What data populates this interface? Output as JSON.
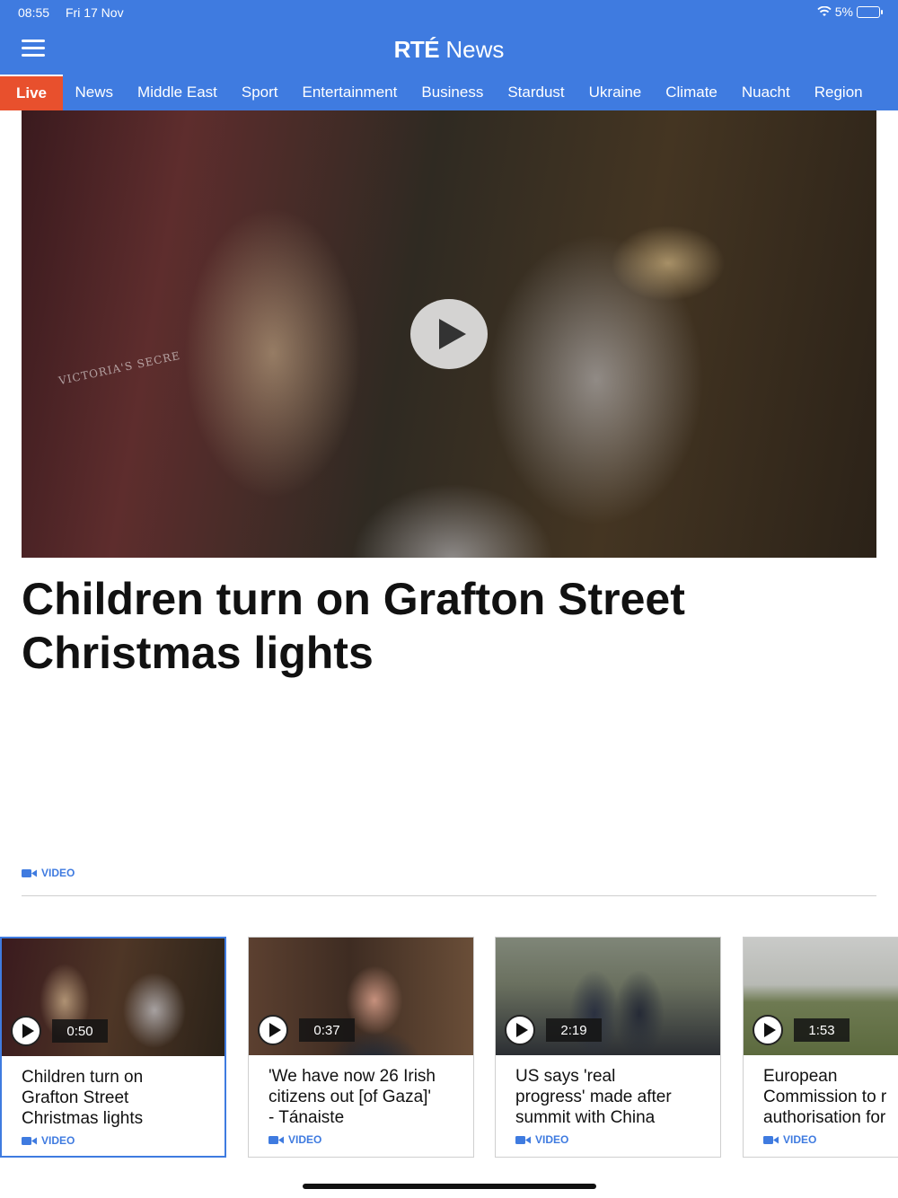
{
  "status": {
    "time": "08:55",
    "date": "Fri 17 Nov",
    "battery": "5%"
  },
  "header": {
    "brand_bold": "RTÉ",
    "brand_rest": "News"
  },
  "nav": {
    "items": [
      "Live",
      "News",
      "Middle East",
      "Sport",
      "Entertainment",
      "Business",
      "Stardust",
      "Ukraine",
      "Climate",
      "Nuacht",
      "Region"
    ]
  },
  "hero": {
    "sign_text": "VICTORIA'S SECRE",
    "headline": "Children turn on Grafton Street Christmas lights",
    "tag": "VIDEO"
  },
  "cards": [
    {
      "duration": "0:50",
      "title": "Children turn on\nGrafton Street\nChristmas lights",
      "tag": "VIDEO"
    },
    {
      "duration": "0:37",
      "title": "'We have now 26 Irish\ncitizens out [of Gaza]'\n- Tánaiste",
      "tag": "VIDEO"
    },
    {
      "duration": "2:19",
      "title": "US says 'real\nprogress' made after\nsummit with China",
      "tag": "VIDEO"
    },
    {
      "duration": "1:53",
      "title": "European\nCommission to r\nauthorisation for",
      "tag": "VIDEO"
    }
  ],
  "colors": {
    "brand_blue": "#3f7be0",
    "live_red": "#e8502d"
  }
}
